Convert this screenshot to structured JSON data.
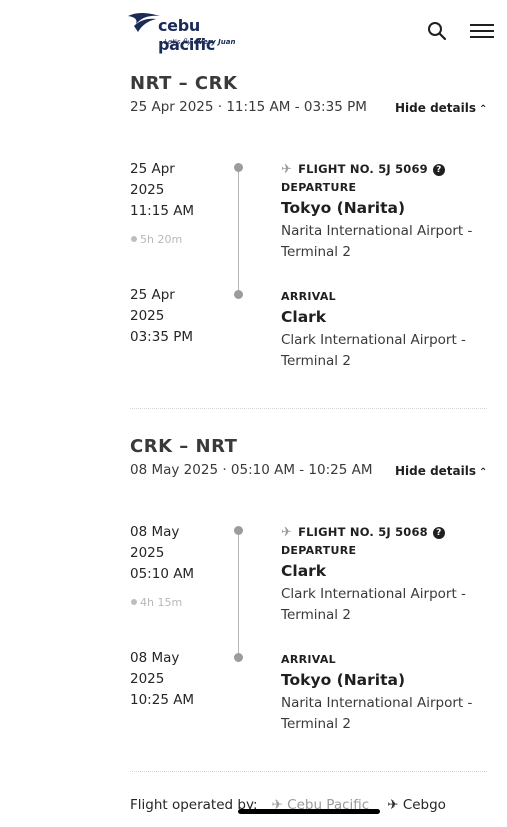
{
  "header": {
    "logo_text": "cebu pacific",
    "logo_tag_prefix": "Let's fly ",
    "logo_tag_bold": "every Juan",
    "search_icon": "search-icon",
    "menu_icon": "hamburger-menu-icon"
  },
  "flights": [
    {
      "route": "NRT – CRK",
      "datetime": "25 Apr 2025 · 11:15 AM - 03:35 PM",
      "toggle_label": "Hide details",
      "departure_date_line1": "25 Apr",
      "departure_date_line2": "2025",
      "departure_time": "11:15 AM",
      "duration": "5h 20m",
      "flight_no": "FLIGHT NO. 5J 5069",
      "departure_tag": "DEPARTURE",
      "departure_city": "Tokyo (Narita)",
      "departure_airport": "Narita International Airport - Terminal 2",
      "arrival_date_line1": "25 Apr",
      "arrival_date_line2": "2025",
      "arrival_time": "03:35 PM",
      "arrival_tag": "ARRIVAL",
      "arrival_city": "Clark",
      "arrival_airport": "Clark International Airport - Terminal 2"
    },
    {
      "route": "CRK – NRT",
      "datetime": "08 May 2025 · 05:10 AM - 10:25 AM",
      "toggle_label": "Hide details",
      "departure_date_line1": "08 May",
      "departure_date_line2": "2025",
      "departure_time": "05:10 AM",
      "duration": "4h 15m",
      "flight_no": "FLIGHT NO. 5J 5068",
      "departure_tag": "DEPARTURE",
      "departure_city": "Clark",
      "departure_airport": "Clark International Airport - Terminal 2",
      "arrival_date_line1": "08 May",
      "arrival_date_line2": "2025",
      "arrival_time": "10:25 AM",
      "arrival_tag": "ARRIVAL",
      "arrival_city": "Tokyo (Narita)",
      "arrival_airport": "Narita International Airport - Terminal 2"
    }
  ],
  "footer": {
    "operated_label": "Flight operated by:",
    "operator_1": "Cebu Pacific",
    "operator_2": "Cebgo"
  }
}
